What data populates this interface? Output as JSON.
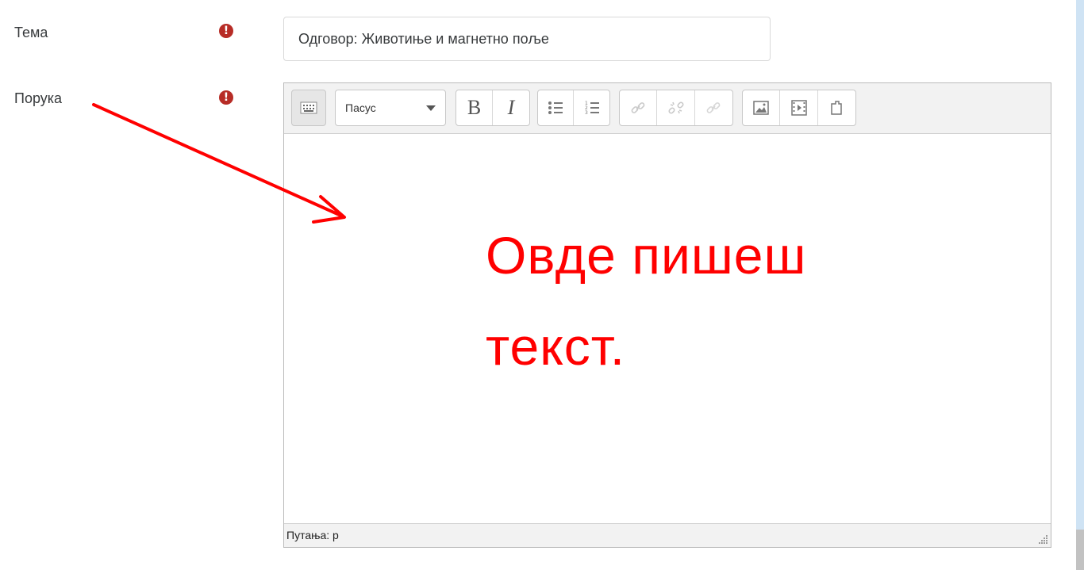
{
  "form": {
    "subject": {
      "label": "Тема",
      "value": "Одговор: Животиње и магнетно поље",
      "required_icon": "exclamation-circle-icon"
    },
    "message": {
      "label": "Порука",
      "required_icon": "exclamation-circle-icon",
      "editor": {
        "toolbar": {
          "toggle_icon": "keyboard-toggle-icon",
          "format_select": "Пасус",
          "bold": "B",
          "italic": "I",
          "bullet_list_icon": "unordered-list-icon",
          "numbered_list_icon": "ordered-list-icon",
          "link_icon": "link-icon",
          "unlink_icon": "unlink-icon",
          "disabled_link_icon": "link-disabled-icon",
          "image_icon": "image-icon",
          "media_icon": "media-icon",
          "file_icon": "file-icon"
        },
        "content": "",
        "status_path": "Путања: p"
      }
    }
  },
  "annotation": {
    "line1": "Овде пишеш",
    "line2": "текст.",
    "color": "#ff0000"
  },
  "colors": {
    "required": "#b72c26",
    "link_blue": "#0f6cbf"
  }
}
